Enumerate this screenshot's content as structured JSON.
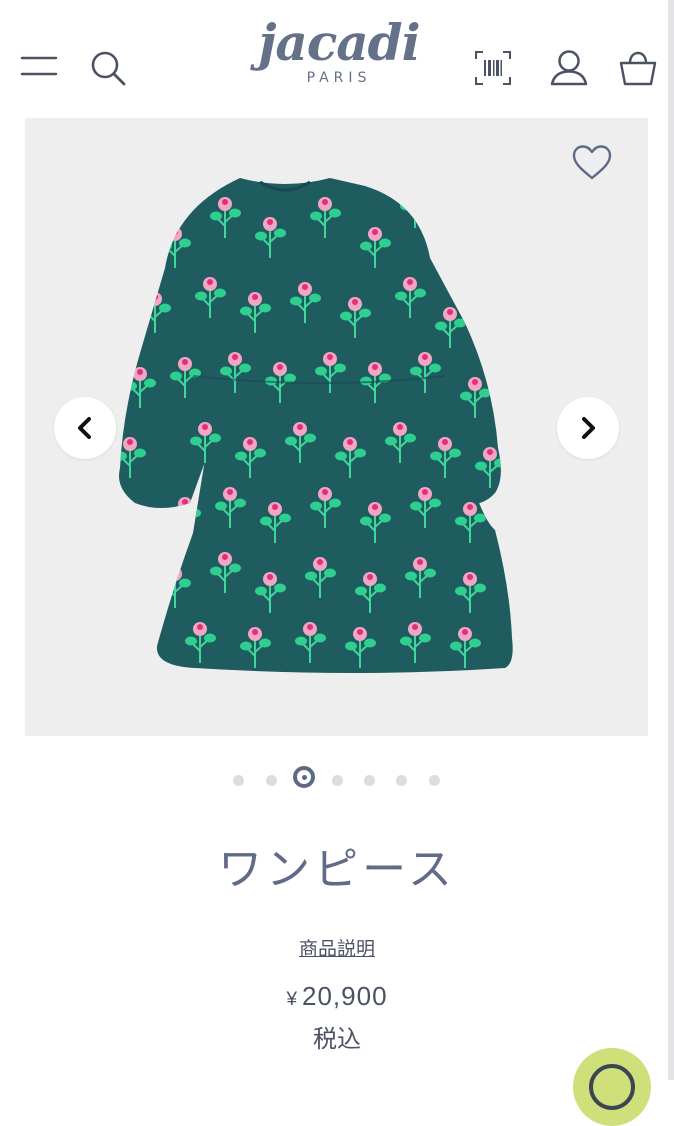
{
  "header": {
    "logo": {
      "main": "jacadi",
      "sub": "PARIS"
    },
    "icons": [
      "menu-icon",
      "search-icon",
      "barcode-scan-icon",
      "account-icon",
      "cart-icon"
    ]
  },
  "product": {
    "title": "ワンピース",
    "description_link": "商品説明",
    "price": {
      "currency": "¥",
      "amount": "20,900"
    },
    "tax_note": "税込"
  },
  "gallery": {
    "slide_count": 7,
    "active_slide": 3,
    "icons": [
      "heart-icon",
      "chevron-left-icon",
      "chevron-right-icon"
    ]
  },
  "colors": {
    "brand": "#657089",
    "dress": "#1f5c60",
    "flower_pink": "#f2a6c4",
    "flower_magenta": "#e0307a",
    "leaf_green": "#2fcf90",
    "chat_button": "#cfe07b"
  }
}
